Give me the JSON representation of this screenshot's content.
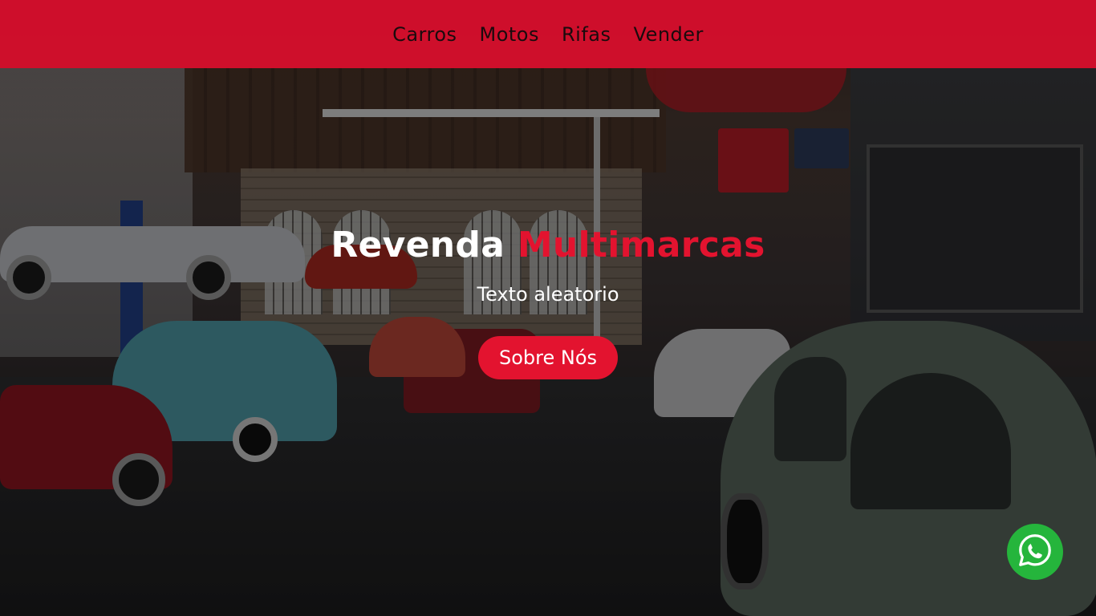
{
  "nav": {
    "items": [
      {
        "label": "Carros"
      },
      {
        "label": "Motos"
      },
      {
        "label": "Rifas"
      },
      {
        "label": "Vender"
      }
    ]
  },
  "hero": {
    "title_main": "Revenda",
    "title_accent": "Multimarcas",
    "subtitle": "Texto aleatorio",
    "cta_label": "Sobre Nós",
    "background_image": "garage-showroom-photo"
  },
  "whatsapp": {
    "icon": "whatsapp-icon"
  },
  "colors": {
    "accent": "#e3132f",
    "navbar": "#dc0e2d",
    "whatsapp": "#25b53c"
  }
}
